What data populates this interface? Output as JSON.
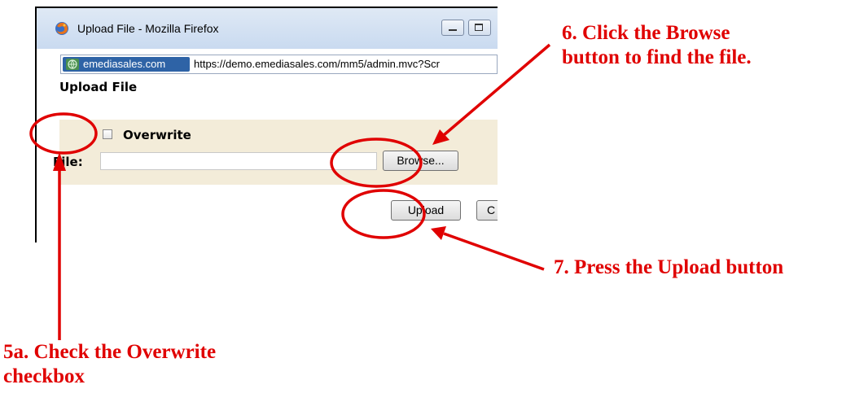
{
  "window": {
    "title": "Upload File - Mozilla Firefox",
    "site_identity": "emediasales.com",
    "url": "https://demo.emediasales.com/mm5/admin.mvc?Scr"
  },
  "dialog": {
    "heading": "Upload File",
    "overwrite_label": "Overwrite",
    "overwrite_checked": false,
    "file_label": "File:",
    "file_value": "",
    "browse_label": "Browse...",
    "upload_label": "Upload",
    "cancel_label": "C"
  },
  "annotations": {
    "step6_line1": "6. Click the Browse",
    "step6_line2": "button to find the file.",
    "step7": "7. Press the Upload button",
    "step5a_line1": "5a. Check the Overwrite",
    "step5a_line2": "checkbox"
  },
  "colors": {
    "annotation": "#e00000",
    "panel": "#f3ecd9",
    "site_chip": "#2e63a6"
  },
  "icons": [
    "firefox-icon",
    "globe-icon",
    "minimize-icon",
    "maximize-icon"
  ]
}
